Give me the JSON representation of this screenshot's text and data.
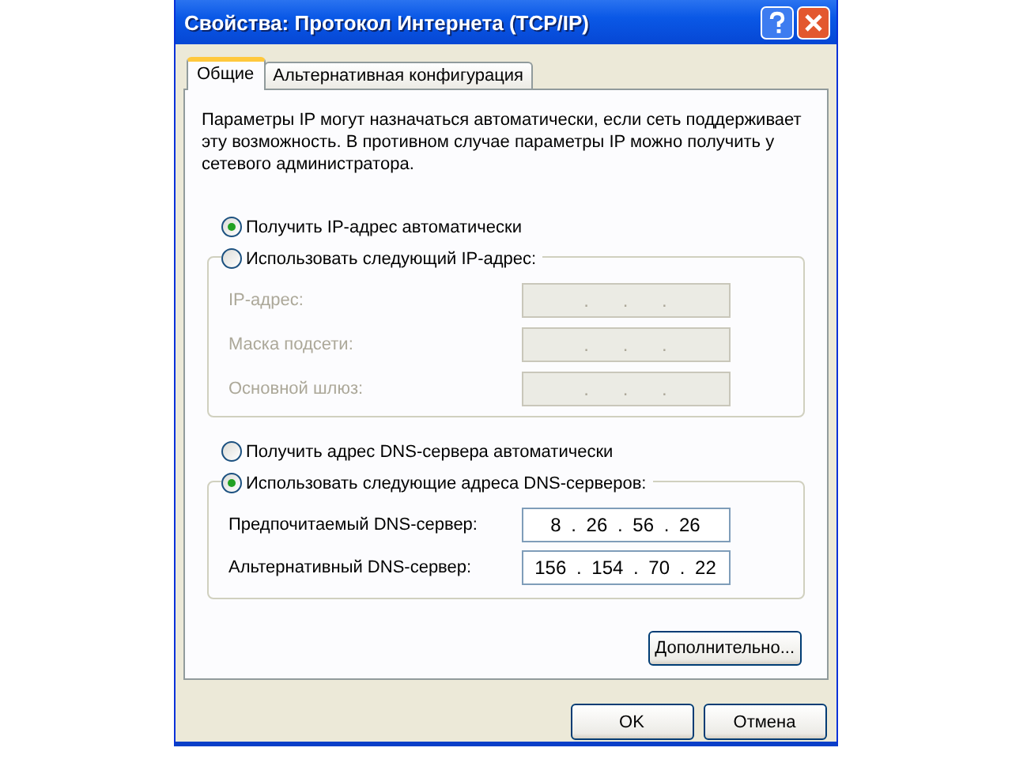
{
  "window": {
    "title": "Свойства: Протокол Интернета (TCP/IP)"
  },
  "tabs": [
    {
      "label": "Общие",
      "selected": true
    },
    {
      "label": "Альтернативная конфигурация",
      "selected": false
    }
  ],
  "description": "Параметры IP могут назначаться автоматически, если сеть поддерживает эту возможность. В противном случае параметры IP можно получить у сетевого администратора.",
  "ip_options": [
    {
      "label": "Получить IP-адрес автоматически",
      "selected": true
    },
    {
      "label": "Использовать следующий IP-адрес:",
      "selected": false
    }
  ],
  "ip_group": {
    "disabled": true,
    "fields": [
      {
        "label": "IP-адрес:",
        "value": ". . ."
      },
      {
        "label": "Маска подсети:",
        "value": ". . ."
      },
      {
        "label": "Основной шлюз:",
        "value": ". . ."
      }
    ]
  },
  "dns_options": [
    {
      "label": "Получить адрес DNS-сервера автоматически",
      "selected": false
    },
    {
      "label": "Использовать следующие адреса DNS-серверов:",
      "selected": true
    }
  ],
  "dns_group": {
    "disabled": false,
    "fields": [
      {
        "label": "Предпочитаемый DNS-сервер:",
        "value": "8 . 26 . 56 . 26"
      },
      {
        "label": "Альтернативный DNS-сервер:",
        "value": "156 . 154 . 70 . 22"
      }
    ]
  },
  "advanced_button": "Дополнительно...",
  "buttons": [
    "OK",
    "Отмена"
  ]
}
